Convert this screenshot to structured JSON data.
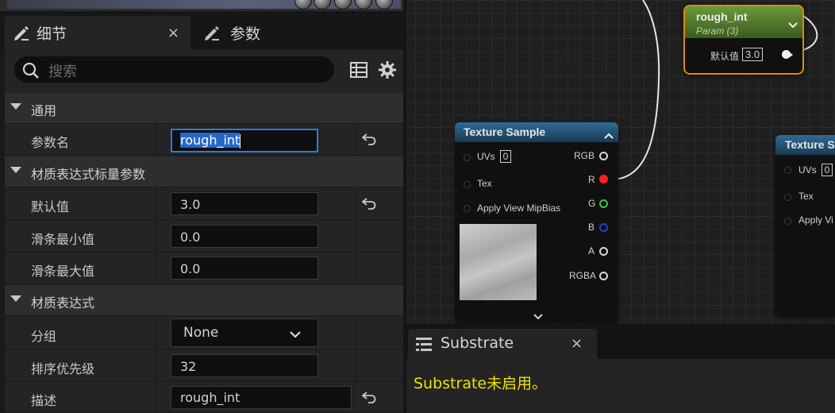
{
  "details_panel": {
    "tab_title": "细节",
    "tab2_title": "参数",
    "close_glyph": "×",
    "search_placeholder": "搜索",
    "sections": [
      {
        "title": "通用"
      },
      {
        "title": "材质表达式标量参数"
      },
      {
        "title": "材质表达式"
      }
    ],
    "rows": {
      "param_name": {
        "label": "参数名",
        "value": "rough_int"
      },
      "default_value": {
        "label": "默认值",
        "value": "3.0"
      },
      "slider_min": {
        "label": "滑条最小值",
        "value": "0.0"
      },
      "slider_max": {
        "label": "滑条最大值",
        "value": "0.0"
      },
      "group": {
        "label": "分组",
        "value": "None"
      },
      "sort_priority": {
        "label": "排序优先级",
        "value": "32"
      },
      "description": {
        "label": "描述",
        "value": "rough_int"
      }
    }
  },
  "graph": {
    "param_node": {
      "title": "rough_int",
      "subtitle": "Param (3)",
      "default_label": "默认值",
      "default_value": "3.0"
    },
    "texture_node_1": {
      "title": "Texture Sample",
      "inputs": [
        {
          "label": "UVs",
          "value": "0"
        },
        {
          "label": "Tex"
        },
        {
          "label": "Apply View MipBias"
        }
      ],
      "outputs": [
        {
          "label": "RGB"
        },
        {
          "label": "R"
        },
        {
          "label": "G"
        },
        {
          "label": "B"
        },
        {
          "label": "A"
        },
        {
          "label": "RGBA"
        }
      ]
    },
    "texture_node_2": {
      "title": "Texture Sa",
      "inputs": [
        {
          "label": "UVs",
          "value": "0"
        },
        {
          "label": "Tex"
        },
        {
          "label": "Apply Vi"
        }
      ]
    },
    "colors": {
      "r_pin": "#ff2020",
      "g_pin": "#2ecc40",
      "b_pin": "#2a3ad8",
      "param_header": "#5a8a2c",
      "param_border": "#e08a10",
      "texture_header": "#2f6c95"
    }
  },
  "substrate_panel": {
    "tab_title": "Substrate",
    "close_glyph": "×",
    "message": "Substrate未启用。"
  }
}
